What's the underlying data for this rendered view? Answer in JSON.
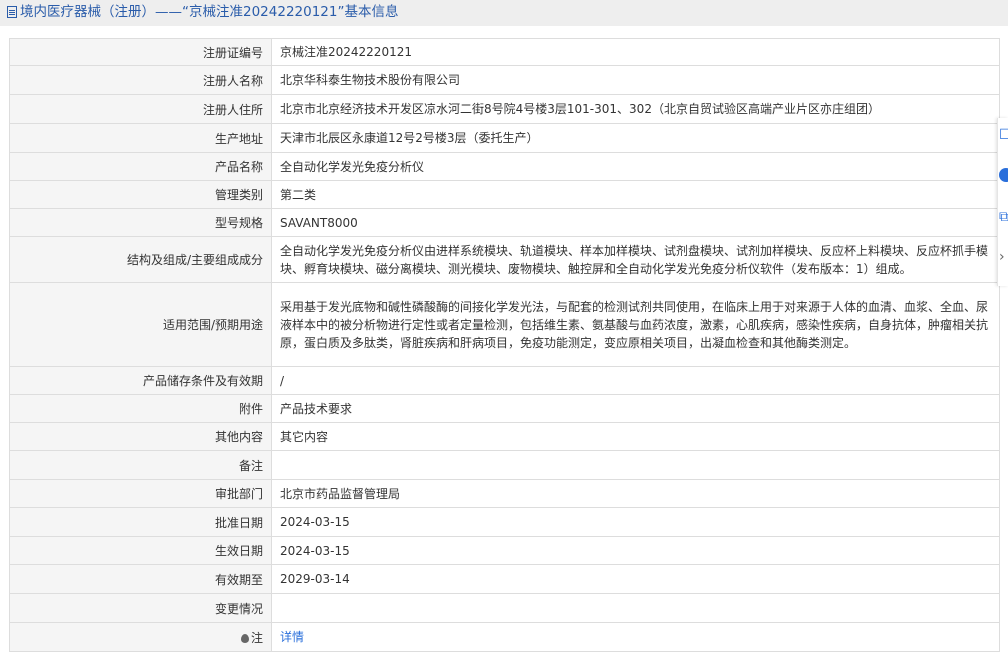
{
  "page": {
    "title": "境内医疗器械（注册）——“京械注准20242220121”基本信息"
  },
  "rows": [
    {
      "label": "注册证编号",
      "value": "京械注准20242220121"
    },
    {
      "label": "注册人名称",
      "value": "北京华科泰生物技术股份有限公司"
    },
    {
      "label": "注册人住所",
      "value": "北京市北京经济技术开发区凉水河二街8号院4号楼3层101-301、302（北京自贸试验区高端产业片区亦庄组团）"
    },
    {
      "label": "生产地址",
      "value": "天津市北辰区永康道12号2号楼3层（委托生产）"
    },
    {
      "label": "产品名称",
      "value": "全自动化学发光免疫分析仪"
    },
    {
      "label": "管理类别",
      "value": "第二类"
    },
    {
      "label": "型号规格",
      "value": "SAVANT8000"
    },
    {
      "label": "结构及组成/主要组成成分",
      "value": "全自动化学发光免疫分析仪由进样系统模块、轨道模块、样本加样模块、试剂盘模块、试剂加样模块、反应杯上料模块、反应杯抓手模块、孵育块模块、磁分离模块、测光模块、废物模块、触控屏和全自动化学发光免疫分析仪软件（发布版本：1）组成。"
    },
    {
      "label": "适用范围/预期用途",
      "value": "采用基于发光底物和碱性磷酸酶的间接化学发光法，与配套的检测试剂共同使用，在临床上用于对来源于人体的血清、血浆、全血、尿液样本中的被分析物进行定性或者定量检测，包括维生素、氨基酸与血药浓度，激素，心肌疾病，感染性疾病，自身抗体，肿瘤相关抗原，蛋白质及多肽类，肾脏疾病和肝病项目，免疫功能测定，变应原相关项目，出凝血检查和其他酶类测定。"
    },
    {
      "label": "产品储存条件及有效期",
      "value": "/"
    },
    {
      "label": "附件",
      "value": "产品技术要求"
    },
    {
      "label": "其他内容",
      "value": "其它内容"
    },
    {
      "label": "备注",
      "value": ""
    },
    {
      "label": "审批部门",
      "value": "北京市药品监督管理局"
    },
    {
      "label": "批准日期",
      "value": "2024-03-15"
    },
    {
      "label": "生效日期",
      "value": "2024-03-15"
    },
    {
      "label": "有效期至",
      "value": "2029-03-14"
    },
    {
      "label": "变更情况",
      "value": ""
    }
  ],
  "note": {
    "label": "注",
    "link_text": "详情"
  },
  "side_toolbar": {
    "icons": [
      "document-icon",
      "question-icon",
      "copy-icon",
      "chevron-right-icon"
    ]
  },
  "colors": {
    "title_bar_bg": "#eeeeee",
    "title_text": "#2a5caa",
    "link": "#2a6fdb",
    "label_bg": "#f5f5f5",
    "border": "#dddddd"
  }
}
